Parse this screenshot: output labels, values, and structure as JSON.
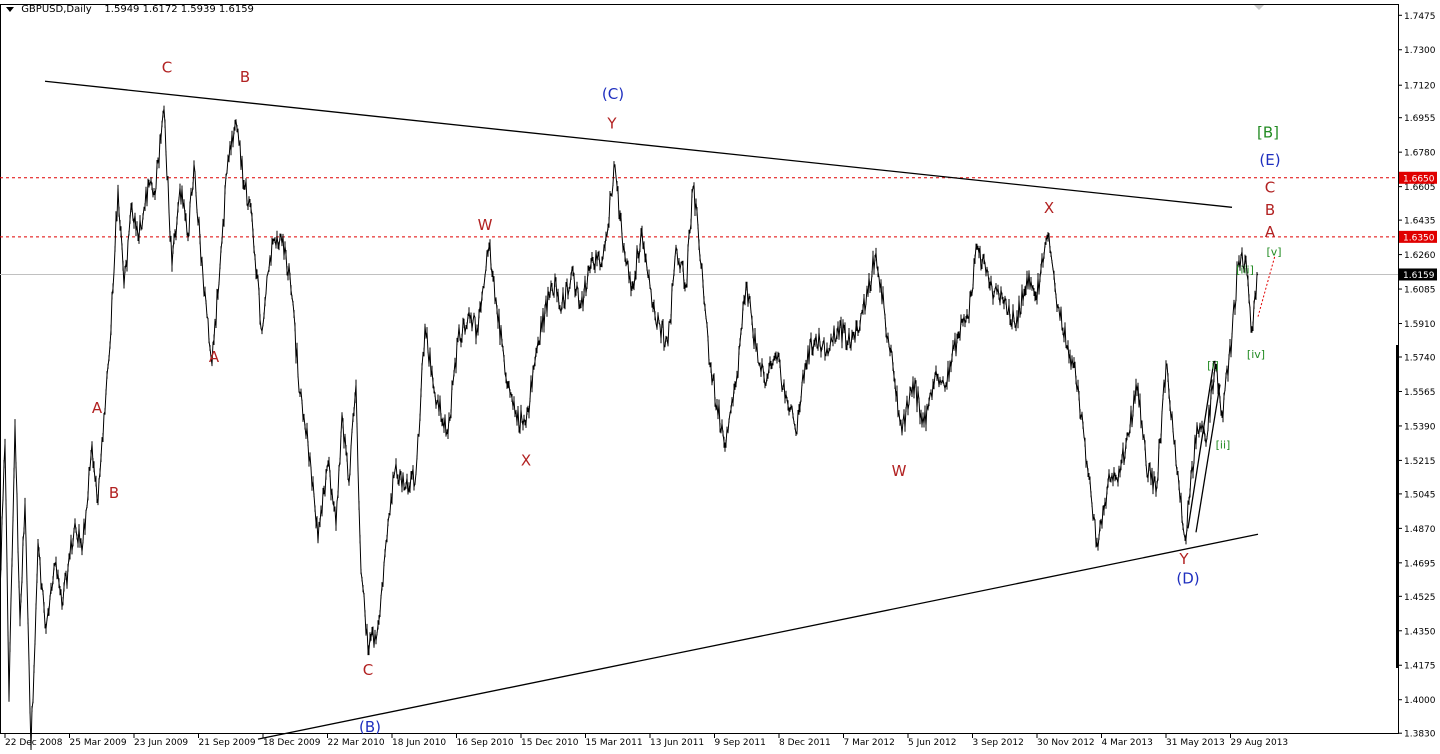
{
  "header": {
    "symbol": "GBPUSD,Daily",
    "ohlc": "1.5949 1.6172 1.5939 1.6159"
  },
  "colors": {
    "background": "#ffffff",
    "price": "#000000",
    "wave_red": "#b22222",
    "wave_blue": "#1f2fbf",
    "wave_green": "#228b22",
    "level_red": "#e00000",
    "current_price_line": "#c0c0c0"
  },
  "chart_data": {
    "type": "line",
    "title": "GBPUSD,Daily",
    "ylim": [
      1.375,
      1.755
    ],
    "x_ticks": [
      "22 Dec 2008",
      "25 Mar 2009",
      "23 Jun 2009",
      "21 Sep 2009",
      "18 Dec 2009",
      "22 Mar 2010",
      "18 Jun 2010",
      "16 Sep 2010",
      "15 Dec 2010",
      "15 Mar 2011",
      "13 Jun 2011",
      "9 Sep 2011",
      "8 Dec 2011",
      "7 Mar 2012",
      "5 Jun 2012",
      "3 Sep 2012",
      "30 Nov 2012",
      "4 Mar 2013",
      "31 May 2013",
      "29 Aug 2013"
    ],
    "y_ticks": [
      "1.7475",
      "1.7300",
      "1.7120",
      "1.6955",
      "1.6780",
      "1.6605",
      "1.6435",
      "1.6260",
      "1.6085",
      "1.5910",
      "1.5740",
      "1.5565",
      "1.5390",
      "1.5215",
      "1.5045",
      "1.4870",
      "1.4695",
      "1.4525",
      "1.4350",
      "1.4175",
      "1.4000",
      "1.3830"
    ],
    "price_labels": [
      {
        "text": "1.6650",
        "value": 1.665,
        "style": "red"
      },
      {
        "text": "1.6350",
        "value": 1.635,
        "style": "red"
      },
      {
        "text": "1.6159",
        "value": 1.6159,
        "style": "current"
      }
    ],
    "pivots": [
      {
        "t": 0,
        "v": 1.455
      },
      {
        "t": 5,
        "v": 1.53
      },
      {
        "t": 9,
        "v": 1.4
      },
      {
        "t": 15,
        "v": 1.54
      },
      {
        "t": 20,
        "v": 1.44
      },
      {
        "t": 25,
        "v": 1.5
      },
      {
        "t": 31,
        "v": 1.375
      },
      {
        "t": 38,
        "v": 1.48
      },
      {
        "t": 46,
        "v": 1.436
      },
      {
        "t": 56,
        "v": 1.47
      },
      {
        "t": 63,
        "v": 1.45
      },
      {
        "t": 75,
        "v": 1.49
      },
      {
        "t": 82,
        "v": 1.475
      },
      {
        "t": 92,
        "v": 1.53
      },
      {
        "t": 98,
        "v": 1.5
      },
      {
        "t": 104,
        "v": 1.545
      },
      {
        "t": 110,
        "v": 1.58
      },
      {
        "t": 118,
        "v": 1.66
      },
      {
        "t": 124,
        "v": 1.61
      },
      {
        "t": 132,
        "v": 1.65
      },
      {
        "t": 138,
        "v": 1.635
      },
      {
        "t": 149,
        "v": 1.662
      },
      {
        "t": 155,
        "v": 1.656
      },
      {
        "t": 164,
        "v": 1.7
      },
      {
        "t": 172,
        "v": 1.62
      },
      {
        "t": 180,
        "v": 1.66
      },
      {
        "t": 188,
        "v": 1.635
      },
      {
        "t": 194,
        "v": 1.672
      },
      {
        "t": 203,
        "v": 1.615
      },
      {
        "t": 212,
        "v": 1.57
      },
      {
        "t": 220,
        "v": 1.62
      },
      {
        "t": 228,
        "v": 1.675
      },
      {
        "t": 237,
        "v": 1.69
      },
      {
        "t": 245,
        "v": 1.66
      },
      {
        "t": 252,
        "v": 1.645
      },
      {
        "t": 262,
        "v": 1.587
      },
      {
        "t": 270,
        "v": 1.625
      },
      {
        "t": 281,
        "v": 1.636
      },
      {
        "t": 290,
        "v": 1.615
      },
      {
        "t": 300,
        "v": 1.555
      },
      {
        "t": 308,
        "v": 1.53
      },
      {
        "t": 318,
        "v": 1.48
      },
      {
        "t": 328,
        "v": 1.52
      },
      {
        "t": 336,
        "v": 1.488
      },
      {
        "t": 342,
        "v": 1.545
      },
      {
        "t": 349,
        "v": 1.51
      },
      {
        "t": 356,
        "v": 1.56
      },
      {
        "t": 361,
        "v": 1.465
      },
      {
        "t": 368,
        "v": 1.425
      },
      {
        "t": 378,
        "v": 1.438
      },
      {
        "t": 388,
        "v": 1.49
      },
      {
        "t": 396,
        "v": 1.52
      },
      {
        "t": 405,
        "v": 1.507
      },
      {
        "t": 416,
        "v": 1.515
      },
      {
        "t": 425,
        "v": 1.59
      },
      {
        "t": 435,
        "v": 1.555
      },
      {
        "t": 448,
        "v": 1.535
      },
      {
        "t": 458,
        "v": 1.583
      },
      {
        "t": 469,
        "v": 1.597
      },
      {
        "t": 478,
        "v": 1.586
      },
      {
        "t": 489,
        "v": 1.63
      },
      {
        "t": 497,
        "v": 1.598
      },
      {
        "t": 508,
        "v": 1.56
      },
      {
        "t": 515,
        "v": 1.545
      },
      {
        "t": 526,
        "v": 1.54
      },
      {
        "t": 538,
        "v": 1.582
      },
      {
        "t": 549,
        "v": 1.605
      },
      {
        "t": 556,
        "v": 1.612
      },
      {
        "t": 562,
        "v": 1.6
      },
      {
        "t": 571,
        "v": 1.615
      },
      {
        "t": 581,
        "v": 1.6
      },
      {
        "t": 592,
        "v": 1.625
      },
      {
        "t": 600,
        "v": 1.62
      },
      {
        "t": 608,
        "v": 1.64
      },
      {
        "t": 614,
        "v": 1.672
      },
      {
        "t": 624,
        "v": 1.63
      },
      {
        "t": 632,
        "v": 1.61
      },
      {
        "t": 642,
        "v": 1.638
      },
      {
        "t": 652,
        "v": 1.6
      },
      {
        "t": 660,
        "v": 1.59
      },
      {
        "t": 668,
        "v": 1.58
      },
      {
        "t": 676,
        "v": 1.63
      },
      {
        "t": 686,
        "v": 1.61
      },
      {
        "t": 693,
        "v": 1.66
      },
      {
        "t": 702,
        "v": 1.62
      },
      {
        "t": 710,
        "v": 1.57
      },
      {
        "t": 717,
        "v": 1.55
      },
      {
        "t": 726,
        "v": 1.53
      },
      {
        "t": 736,
        "v": 1.56
      },
      {
        "t": 746,
        "v": 1.61
      },
      {
        "t": 756,
        "v": 1.578
      },
      {
        "t": 766,
        "v": 1.56
      },
      {
        "t": 776,
        "v": 1.575
      },
      {
        "t": 786,
        "v": 1.555
      },
      {
        "t": 796,
        "v": 1.535
      },
      {
        "t": 805,
        "v": 1.57
      },
      {
        "t": 816,
        "v": 1.585
      },
      {
        "t": 828,
        "v": 1.575
      },
      {
        "t": 838,
        "v": 1.59
      },
      {
        "t": 850,
        "v": 1.58
      },
      {
        "t": 860,
        "v": 1.59
      },
      {
        "t": 876,
        "v": 1.627
      },
      {
        "t": 888,
        "v": 1.585
      },
      {
        "t": 902,
        "v": 1.535
      },
      {
        "t": 913,
        "v": 1.562
      },
      {
        "t": 924,
        "v": 1.54
      },
      {
        "t": 935,
        "v": 1.565
      },
      {
        "t": 946,
        "v": 1.56
      },
      {
        "t": 958,
        "v": 1.585
      },
      {
        "t": 968,
        "v": 1.594
      },
      {
        "t": 977,
        "v": 1.63
      },
      {
        "t": 990,
        "v": 1.61
      },
      {
        "t": 1002,
        "v": 1.605
      },
      {
        "t": 1015,
        "v": 1.59
      },
      {
        "t": 1027,
        "v": 1.615
      },
      {
        "t": 1036,
        "v": 1.605
      },
      {
        "t": 1048,
        "v": 1.635
      },
      {
        "t": 1058,
        "v": 1.6
      },
      {
        "t": 1068,
        "v": 1.58
      },
      {
        "t": 1078,
        "v": 1.56
      },
      {
        "t": 1086,
        "v": 1.52
      },
      {
        "t": 1097,
        "v": 1.48
      },
      {
        "t": 1108,
        "v": 1.51
      },
      {
        "t": 1118,
        "v": 1.51
      },
      {
        "t": 1128,
        "v": 1.535
      },
      {
        "t": 1138,
        "v": 1.56
      },
      {
        "t": 1146,
        "v": 1.52
      },
      {
        "t": 1156,
        "v": 1.505
      },
      {
        "t": 1166,
        "v": 1.57
      },
      {
        "t": 1176,
        "v": 1.52
      },
      {
        "t": 1185,
        "v": 1.482
      },
      {
        "t": 1197,
        "v": 1.54
      },
      {
        "t": 1206,
        "v": 1.53
      },
      {
        "t": 1215,
        "v": 1.57
      },
      {
        "t": 1222,
        "v": 1.545
      },
      {
        "t": 1232,
        "v": 1.585
      },
      {
        "t": 1238,
        "v": 1.62
      },
      {
        "t": 1245,
        "v": 1.6235
      },
      {
        "t": 1252,
        "v": 1.588
      },
      {
        "t": 1258,
        "v": 1.6159
      }
    ],
    "projection": [
      {
        "t": 1258,
        "v": 1.5945
      },
      {
        "t": 1275,
        "v": 1.6255
      }
    ],
    "trendlines": [
      {
        "name": "upper-trendline",
        "from": {
          "t": 45,
          "v": 1.714
        },
        "to": {
          "t": 1232,
          "v": 1.65
        }
      },
      {
        "name": "lower-trendline",
        "from": {
          "t": 258,
          "v": 1.38
        },
        "to": {
          "t": 1258,
          "v": 1.484
        }
      },
      {
        "name": "wave-inner-line",
        "from": {
          "t": 1188,
          "v": 1.487
        },
        "to": {
          "t": 1214,
          "v": 1.572
        }
      },
      {
        "name": "wave-inner-line",
        "from": {
          "t": 1196,
          "v": 1.485
        },
        "to": {
          "t": 1220,
          "v": 1.56
        }
      }
    ],
    "annotations": [
      {
        "text": "C",
        "color": "red",
        "t": 167,
        "v": 1.7185
      },
      {
        "text": "B",
        "color": "red",
        "t": 245,
        "v": 1.7135
      },
      {
        "text": "A",
        "color": "red",
        "t": 214,
        "v": 1.5715
      },
      {
        "text": "A",
        "color": "red",
        "t": 97,
        "v": 1.5455
      },
      {
        "text": "B",
        "color": "red",
        "t": 114,
        "v": 1.5025
      },
      {
        "text": "C",
        "color": "red",
        "t": 368,
        "v": 1.4125
      },
      {
        "text": "(B)",
        "color": "blue",
        "t": 370,
        "v": 1.3835
      },
      {
        "text": "W",
        "color": "red",
        "t": 485,
        "v": 1.6385
      },
      {
        "text": "X",
        "color": "red",
        "t": 526,
        "v": 1.519
      },
      {
        "text": "(C)",
        "color": "blue",
        "t": 613,
        "v": 1.705
      },
      {
        "text": "Y",
        "color": "red",
        "t": 612,
        "v": 1.69
      },
      {
        "text": "W",
        "color": "red",
        "t": 899,
        "v": 1.5135
      },
      {
        "text": "X",
        "color": "red",
        "t": 1049,
        "v": 1.647
      },
      {
        "text": "Y",
        "color": "red",
        "t": 1184,
        "v": 1.469
      },
      {
        "text": "(D)",
        "color": "blue",
        "t": 1188,
        "v": 1.459
      },
      {
        "text": "[B]",
        "color": "green",
        "t": 1268,
        "v": 1.6855
      },
      {
        "text": "(E)",
        "color": "blue",
        "t": 1270,
        "v": 1.6715
      },
      {
        "text": "C",
        "color": "red",
        "t": 1270,
        "v": 1.6575
      },
      {
        "text": "B",
        "color": "red",
        "t": 1270,
        "v": 1.646
      },
      {
        "text": "A",
        "color": "red",
        "t": 1270,
        "v": 1.635
      },
      {
        "text": "[v]",
        "color": "green",
        "t": 1274,
        "v": 1.6255
      },
      {
        "text": "[iii]",
        "color": "green",
        "t": 1245,
        "v": 1.6165
      },
      {
        "text": "[iv]",
        "color": "green",
        "t": 1256,
        "v": 1.5735
      },
      {
        "text": "[i]",
        "color": "green",
        "t": 1213,
        "v": 1.568
      },
      {
        "text": "[ii]",
        "color": "green",
        "t": 1223,
        "v": 1.5275
      }
    ]
  }
}
